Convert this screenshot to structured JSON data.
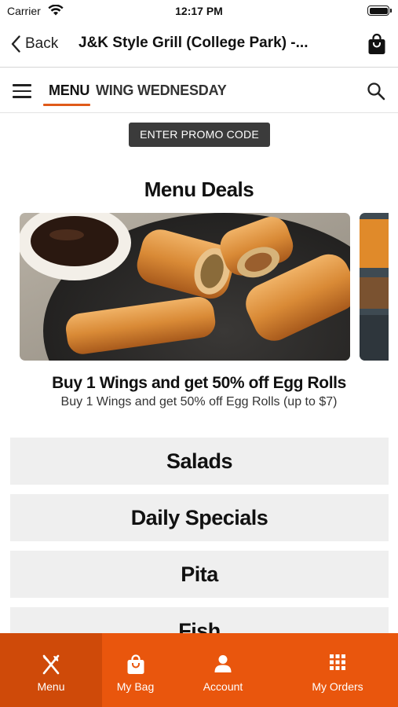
{
  "status_bar": {
    "carrier": "Carrier",
    "time": "12:17 PM"
  },
  "nav": {
    "back_label": "Back",
    "title": "J&K Style Grill (College Park) -..."
  },
  "tabs": [
    {
      "label": "MENU",
      "active": true
    },
    {
      "label": "WING WEDNESDAY",
      "active": false
    }
  ],
  "promo": {
    "label": "ENTER PROMO CODE"
  },
  "deals": {
    "heading": "Menu Deals",
    "items": [
      {
        "title": "Buy 1 Wings and get 50% off Egg Rolls",
        "subtitle": "Buy 1 Wings and get 50% off Egg Rolls (up to $7)"
      }
    ]
  },
  "categories": [
    "Salads",
    "Daily Specials",
    "Pita",
    "Fish"
  ],
  "bottom_nav": [
    {
      "label": "Menu",
      "icon": "fork-knife-icon",
      "active": true
    },
    {
      "label": "My Bag",
      "icon": "bag-icon",
      "active": false
    },
    {
      "label": "Account",
      "icon": "person-icon",
      "active": false
    },
    {
      "label": "My Orders",
      "icon": "grid-icon",
      "active": false
    }
  ],
  "colors": {
    "accent": "#e9560d",
    "accent_active": "#cf4a09",
    "tab_underline": "#e05a1a",
    "promo_button": "#3b3b3b",
    "category_background": "#efefef"
  }
}
